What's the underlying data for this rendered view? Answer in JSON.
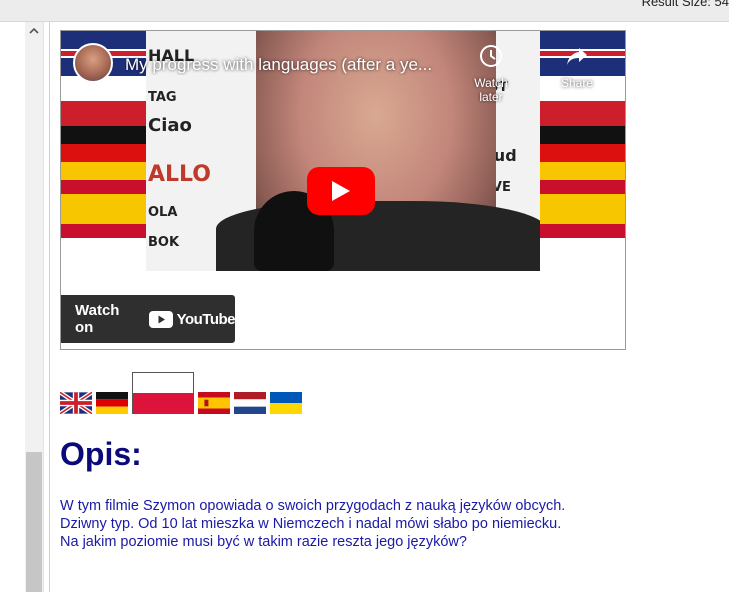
{
  "topbar": {
    "result_size": "Result Size: 54"
  },
  "video": {
    "title": "My progress with languages (after a ye...",
    "watch_later_label": "Watch later",
    "share_label": "Share",
    "watch_on_label": "Watch on",
    "youtube_label": "YouTube"
  },
  "languages": [
    {
      "name": "English",
      "icon": "uk-flag-icon",
      "active": false
    },
    {
      "name": "German",
      "icon": "germany-flag-icon",
      "active": false
    },
    {
      "name": "Polish",
      "icon": "poland-flag-icon",
      "active": true
    },
    {
      "name": "Spanish",
      "icon": "spain-flag-icon",
      "active": false
    },
    {
      "name": "Dutch",
      "icon": "netherlands-flag-icon",
      "active": false
    },
    {
      "name": "Ukrainian",
      "icon": "ukraine-flag-icon",
      "active": false
    }
  ],
  "content": {
    "heading": "Opis:",
    "description_lines": [
      "W tym filmie Szymon opowiada o swoich przygodach z nauką języków obcych.",
      "Dziwny typ. Od 10 lat mieszka w Niemczech i nadal mówi słabo po niemiecku.",
      "Na jakim poziomie musi być w takim razie reszta jego języków?"
    ]
  },
  "colors": {
    "heading": "#0a0a7a",
    "description": "#1a1aa5",
    "play_button": "#ff0000"
  }
}
